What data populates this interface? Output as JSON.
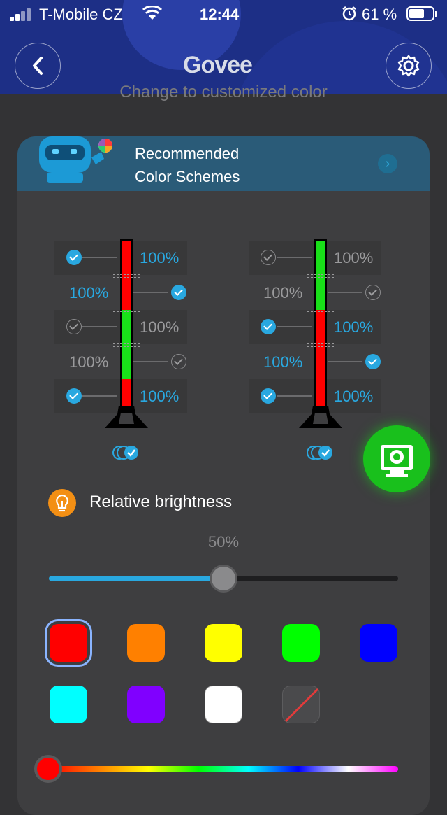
{
  "status_bar": {
    "carrier": "T-Mobile CZ",
    "time": "12:44",
    "battery_pct": "61 %",
    "icons": [
      "signal-icon",
      "wifi-icon",
      "alarm-icon",
      "battery-icon"
    ]
  },
  "header": {
    "logo_text": "Govee",
    "back_icon": "chevron-left-icon",
    "settings_icon": "gear-icon",
    "hint_text": "Change to customized color"
  },
  "banner": {
    "line1": "Recommended",
    "line2": "Color Schemes",
    "icon": "robot-mascot-icon",
    "arrow_icon": "chevron-right-icon"
  },
  "lamps": [
    {
      "segments": [
        {
          "value": "100%",
          "checked": true,
          "color": "#ff0000"
        },
        {
          "value": "100%",
          "checked": true,
          "color": "#ff0000"
        },
        {
          "value": "100%",
          "checked": false,
          "color": "#19e019"
        },
        {
          "value": "100%",
          "checked": false,
          "color": "#19e019"
        },
        {
          "value": "100%",
          "checked": true,
          "color": "#ff0000"
        }
      ],
      "sync_checked": true
    },
    {
      "segments": [
        {
          "value": "100%",
          "checked": false,
          "color": "#19e019"
        },
        {
          "value": "100%",
          "checked": false,
          "color": "#19e019"
        },
        {
          "value": "100%",
          "checked": true,
          "color": "#ff0000"
        },
        {
          "value": "100%",
          "checked": true,
          "color": "#ff0000"
        },
        {
          "value": "100%",
          "checked": true,
          "color": "#ff0000"
        }
      ],
      "sync_checked": true
    }
  ],
  "brightness": {
    "label": "Relative brightness",
    "value_text": "50%",
    "value": 0.5,
    "icon": "light-bulb-icon"
  },
  "colors": {
    "swatches": [
      "#ff0000",
      "#ff8000",
      "#ffff00",
      "#00ff00",
      "#0000ff",
      "#00ffff",
      "#8000ff",
      "#ffffff",
      "none"
    ],
    "selected_index": 0,
    "hue_value": 0
  },
  "fab_icon": "camera-color-picker-icon"
}
